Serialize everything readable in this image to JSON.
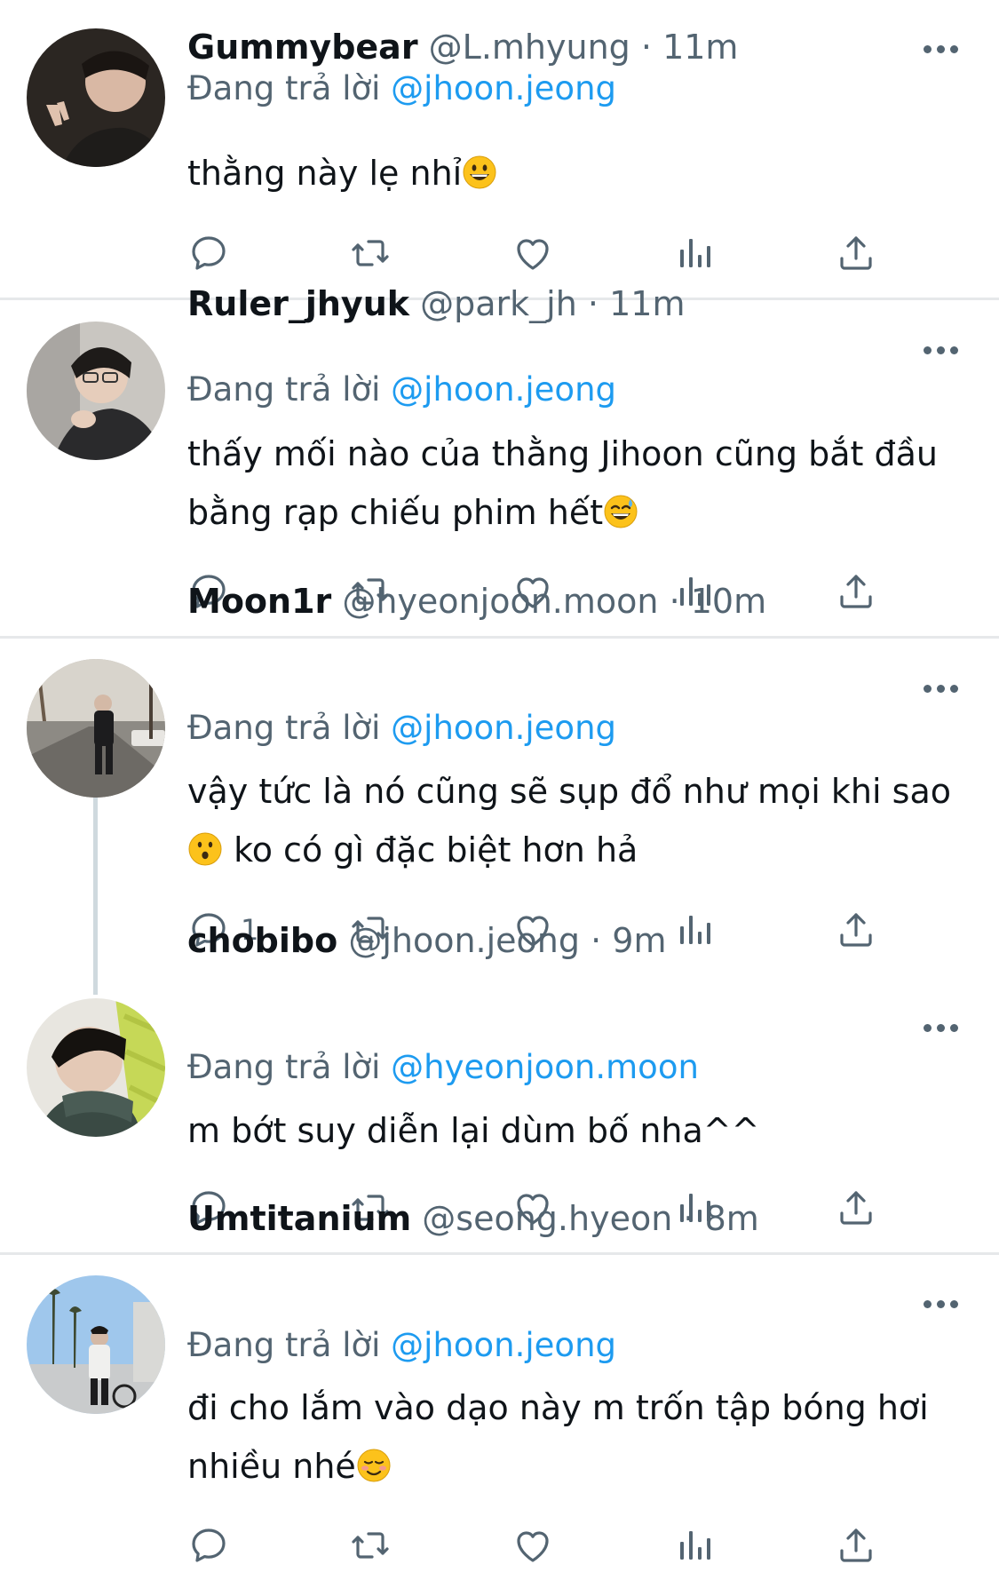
{
  "reply_prefix": "Đang trả lời",
  "separator": "·",
  "colors": {
    "accent": "#1d9bf0",
    "secondary_text": "#536471",
    "divider": "#e6e8ea"
  },
  "action_icons": [
    "reply-icon",
    "retweet-icon",
    "like-icon",
    "analytics-icon",
    "share-icon"
  ],
  "tweets": [
    {
      "name": "Gummybear",
      "handle": "@L.mhyung",
      "time": "11m",
      "reply_to": "@jhoon.jeong",
      "text": "thằng này lẹ nhỉ",
      "emoji": "grinning-face-emoji",
      "reply_count": ""
    },
    {
      "name": "Ruler_jhyuk",
      "handle": "@park_jh",
      "time": "11m",
      "reply_to": "@jhoon.jeong",
      "text": "thấy mối nào của thằng Jihoon cũng bắt đầu bằng rạp chiếu phim hết",
      "emoji": "sweat-smile-emoji",
      "reply_count": ""
    },
    {
      "name": "Moon1r",
      "handle": "@hyeonjoon.moon",
      "time": "10m",
      "reply_to": "@jhoon.jeong",
      "text_before": "vậy tức là nó cũng sẽ sụp đổ như mọi khi sao",
      "text_after": " ko có gì đặc biệt hơn hả",
      "emoji": "hushed-face-emoji",
      "reply_count": "1"
    },
    {
      "name": "chobibo",
      "handle": "@jhoon.jeong",
      "time": "9m",
      "reply_to": "@hyeonjoon.moon",
      "text": "m bớt suy diễn lại dùm bố nha^^",
      "reply_count": ""
    },
    {
      "name": "Umtitanium",
      "handle": "@seong.hyeon",
      "time": "8m",
      "reply_to": "@jhoon.jeong",
      "text": "đi cho lắm vào dạo này m trốn tập bóng hơi nhiều nhé",
      "emoji": "smiling-face-emoji",
      "reply_count": ""
    }
  ]
}
